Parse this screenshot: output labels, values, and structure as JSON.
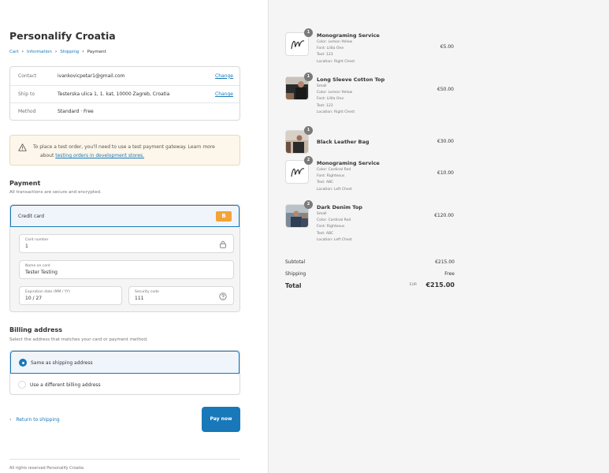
{
  "shop": {
    "title": "Personalify Croatia"
  },
  "breadcrumb": {
    "cart": "Cart",
    "information": "Information",
    "shipping": "Shipping",
    "payment": "Payment"
  },
  "review": {
    "contact_label": "Contact",
    "contact_value": "ivankovicpetar1@gmail.com",
    "shipto_label": "Ship to",
    "shipto_value": "Testerska ulica 1, 1. kat, 10000 Zagreb, Croatia",
    "method_label": "Method",
    "method_value": "Standard · Free",
    "change_label": "Change"
  },
  "notice": {
    "text": "To place a test order, you'll need to use a test payment gateway. Learn more",
    "about": "about",
    "link": "testing orders in development stores."
  },
  "payment": {
    "title": "Payment",
    "subtitle": "All transactions are secure and encrypted.",
    "method_label": "Credit card",
    "badge": "B",
    "card_number_label": "Card number",
    "card_number_value": "1",
    "name_label": "Name on card",
    "name_value": "Tester Testing",
    "expiry_label": "Expiration date (MM / YY)",
    "expiry_value": "10 / 27",
    "cvv_label": "Security code",
    "cvv_value": "111"
  },
  "billing": {
    "title": "Billing address",
    "subtitle": "Select the address that matches your card or payment method.",
    "option_same": "Same as shipping address",
    "option_different": "Use a different billing address"
  },
  "actions": {
    "back": "Return to shipping",
    "pay": "Pay now"
  },
  "footer": {
    "text": "All rights reserved Personalify Croatia"
  },
  "order": {
    "items": [
      {
        "qty": "1",
        "name": "Monograming Service",
        "meta": [
          "Color: Lemon Yellow",
          "Font: Lilita One",
          "Text: 123",
          "Location: Right Chest"
        ],
        "price": "€5.00"
      },
      {
        "qty": "1",
        "name": "Long Sleeve Cotton Top",
        "meta": [
          "Small",
          "Color: Lemon Yellow",
          "Font: Lilita One",
          "Text: 123",
          "Location: Right Chest"
        ],
        "price": "€50.00"
      },
      {
        "qty": "1",
        "name": "Black Leather Bag",
        "meta": [],
        "price": "€30.00"
      },
      {
        "qty": "2",
        "name": "Monograming Service",
        "meta": [
          "Color: Cardinal Red",
          "Font: Righteous",
          "Text: ABC",
          "Location: Left Chest"
        ],
        "price": "€10.00"
      },
      {
        "qty": "2",
        "name": "Dark Denim Top",
        "meta": [
          "Small",
          "Color: Cardinal Red",
          "Font: Righteous",
          "Text: ABC",
          "Location: Left Chest"
        ],
        "price": "€120.00"
      }
    ],
    "subtotal_label": "Subtotal",
    "subtotal_value": "€215.00",
    "shipping_label": "Shipping",
    "shipping_value": "Free",
    "total_label": "Total",
    "total_currency": "EUR",
    "total_value": "€215.00"
  },
  "colors": {
    "accent": "#1878b9",
    "notice_bg": "#fdf6ea",
    "badge": "#f3a33a",
    "sidebar_bg": "#f5f5f5"
  }
}
